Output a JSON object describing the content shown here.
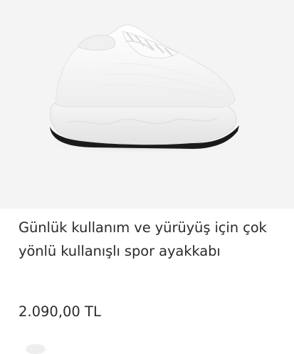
{
  "product": {
    "image_alt": "white running shoe",
    "title": "Günlük kullanım ve yürüyüş için çok yönlü kullanışlı spor ayakkabı",
    "price": "2.090,00 TL"
  },
  "colors": {
    "image_background": "#f4f4f4",
    "shoe": "#ffffff",
    "sole_outline": "#1a1a1a",
    "text": "#2b2b2b"
  }
}
